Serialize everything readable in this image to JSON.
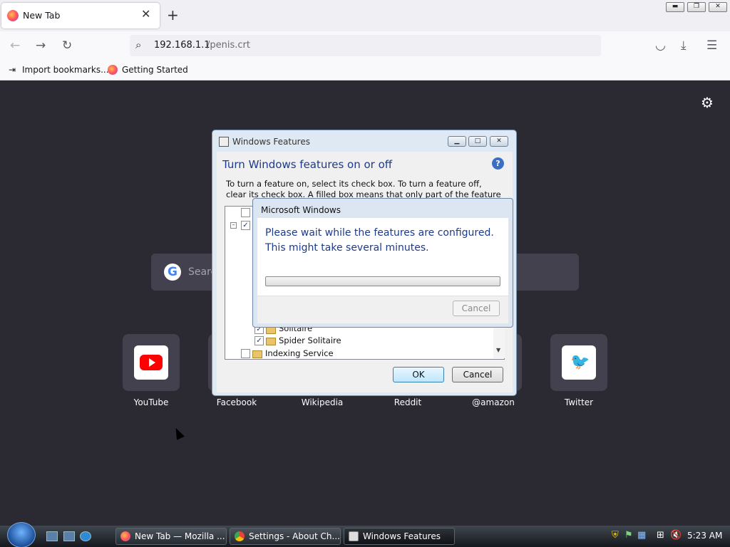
{
  "browser": {
    "tab_title": "New Tab",
    "url_host": "192.168.1.1",
    "url_path": "/penis.crt",
    "bookmarks": [
      "Import bookmarks...",
      "Getting Started"
    ]
  },
  "newtab": {
    "search_placeholder": "Search",
    "tiles": [
      "YouTube",
      "Facebook",
      "Wikipedia",
      "Reddit",
      "@amazon",
      "Twitter"
    ]
  },
  "windows_features": {
    "title": "Windows Features",
    "heading": "Turn Windows features on or off",
    "description": "To turn a feature on, select its check box. To turn a feature off, clear its check box. A filled box means that only part of the feature is turned on.",
    "tree_items": [
      "Solitaire",
      "Spider Solitaire",
      "Indexing Service"
    ],
    "ok_label": "OK",
    "cancel_label": "Cancel"
  },
  "progress_dialog": {
    "title": "Microsoft Windows",
    "message_line1": "Please wait while the features are configured.",
    "message_line2": "This might take several minutes.",
    "cancel_label": "Cancel"
  },
  "taskbar": {
    "items": [
      "New Tab — Mozilla ...",
      "Settings - About Ch...",
      "Windows Features"
    ],
    "clock": "5:23 AM"
  },
  "colors": {
    "newtab_bg": "#2b2a33",
    "tile_bg": "#42414d",
    "dialog_heading": "#1e3a8a"
  }
}
